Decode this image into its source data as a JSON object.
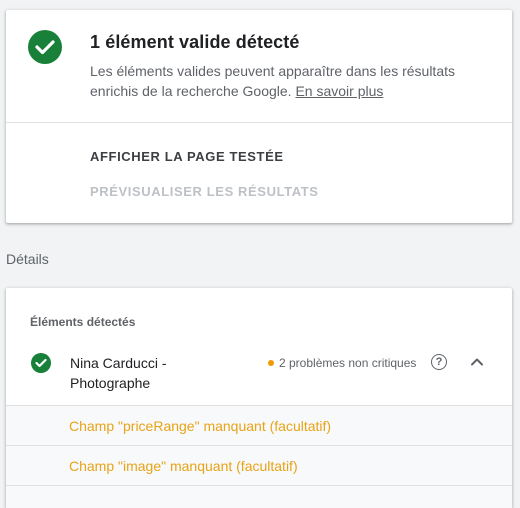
{
  "summary": {
    "title": "1 élément valide détecté",
    "description": "Les éléments valides peuvent apparaître dans les résultats enrichis de la recherche Google.",
    "learn_more": "En savoir plus"
  },
  "actions": {
    "view_tested_page": "AFFICHER LA PAGE TESTÉE",
    "preview_results": "PRÉVISUALISER LES RÉSULTATS"
  },
  "details_label": "Détails",
  "detected": {
    "label": "Éléments détectés",
    "item_name": "Nina Carducci - Photographe",
    "issues": "2 problèmes non critiques",
    "help": "?",
    "issue_list": [
      "Champ \"priceRange\" manquant (facultatif)",
      "Champ \"image\" manquant (facultatif)"
    ]
  },
  "colors": {
    "valid_green": "#188038",
    "warning_orange": "#f29900",
    "issue_text": "#e8a317"
  },
  "icons": {
    "valid": "check-circle-icon",
    "help": "help-circle-icon",
    "collapse": "chevron-up-icon"
  }
}
